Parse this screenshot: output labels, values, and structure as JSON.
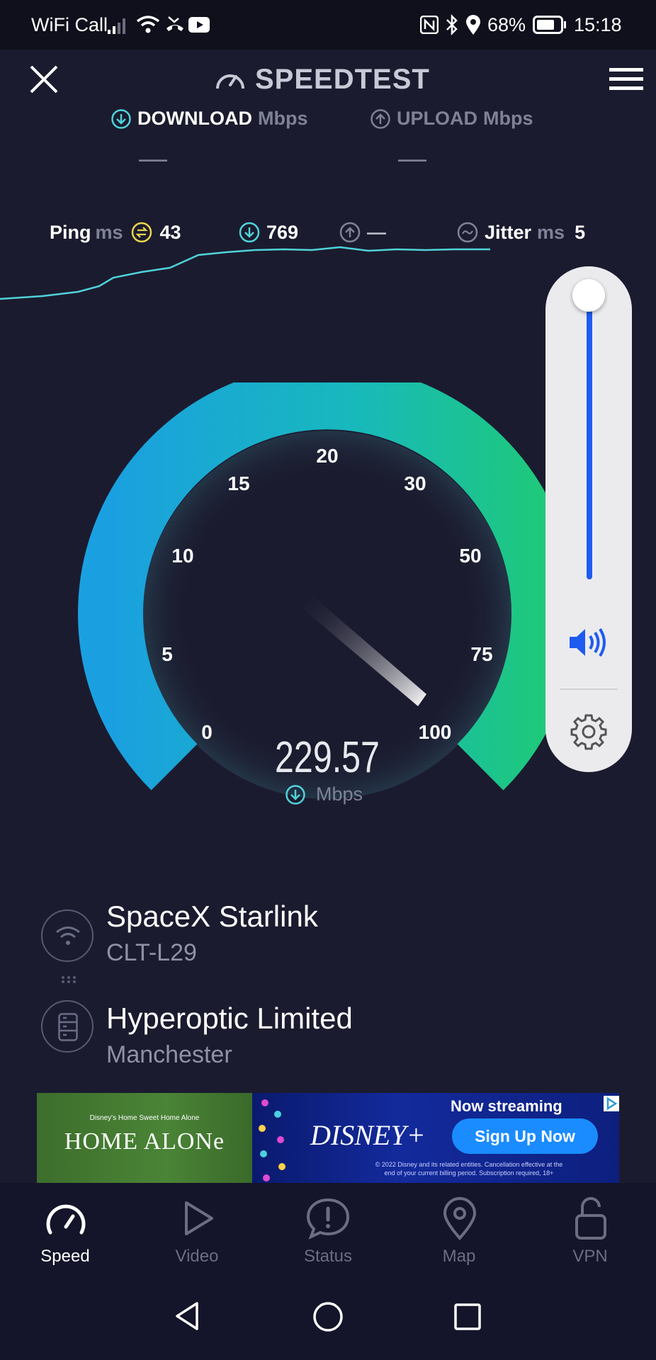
{
  "status_bar": {
    "carrier": "WiFi Call",
    "battery": "68%",
    "time": "15:18"
  },
  "header": {
    "title": "SPEEDTEST",
    "download_label": "DOWNLOAD",
    "upload_label": "UPLOAD",
    "unit": "Mbps",
    "download_value": "—",
    "upload_value": "—"
  },
  "metrics": {
    "ping_label": "Ping",
    "ping_unit": "ms",
    "ping_value": "43",
    "download_latency": "769",
    "upload_latency": "—",
    "jitter_label": "Jitter",
    "jitter_unit": "ms",
    "jitter_value": "5"
  },
  "gauge": {
    "ticks": [
      "0",
      "5",
      "10",
      "15",
      "20",
      "30",
      "50",
      "75",
      "100"
    ],
    "reading": "229.57",
    "unit": "Mbps"
  },
  "connection": {
    "provider": "SpaceX Starlink",
    "device": "CLT-L29",
    "server": "Hyperoptic Limited",
    "location": "Manchester"
  },
  "ad": {
    "left_title": "HOME ALONe",
    "left_small": "Disney's Home Sweet Home Alone",
    "brand": "DISNEY+",
    "headline": "Now streaming",
    "cta": "Sign Up Now",
    "fine_print_1": "© 2022 Disney and its related entities. Cancellation effective at the",
    "fine_print_2": "end of your current billing period. Subscription required, 18+"
  },
  "tabs": [
    {
      "label": "Speed",
      "icon": "speedometer-icon",
      "active": true
    },
    {
      "label": "Video",
      "icon": "play-icon",
      "active": false
    },
    {
      "label": "Status",
      "icon": "alert-icon",
      "active": false
    },
    {
      "label": "Map",
      "icon": "map-pin-icon",
      "active": false
    },
    {
      "label": "VPN",
      "icon": "lock-open-icon",
      "active": false
    }
  ],
  "volume": {
    "level": 1.0
  },
  "colors": {
    "background": "#1b1b2f",
    "accent_teal": "#4fd3d9",
    "gauge_start": "#1aa0e0",
    "gauge_end": "#1ec97a",
    "volume_blue": "#1e5bf0"
  }
}
